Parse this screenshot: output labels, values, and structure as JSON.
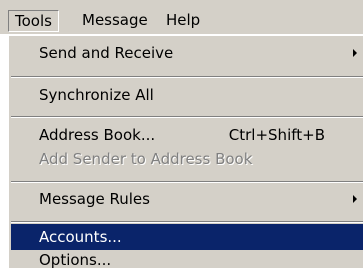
{
  "menubar": {
    "items": [
      {
        "label": "Tools"
      },
      {
        "label": "Message"
      },
      {
        "label": "Help"
      }
    ]
  },
  "tools_menu": {
    "items": [
      {
        "label": "Send and Receive",
        "submenu": true
      },
      {
        "label": "Synchronize All"
      },
      {
        "label": "Address Book...",
        "shortcut": "Ctrl+Shift+B"
      },
      {
        "label": "Add Sender to Address Book",
        "disabled": true
      },
      {
        "label": "Message Rules",
        "submenu": true
      },
      {
        "label": "Accounts...",
        "highlighted": true
      },
      {
        "label": "Options..."
      }
    ]
  },
  "colors": {
    "menu_background": "#d4d0c8",
    "highlight": "#0a246a",
    "disabled_text": "#808080"
  }
}
